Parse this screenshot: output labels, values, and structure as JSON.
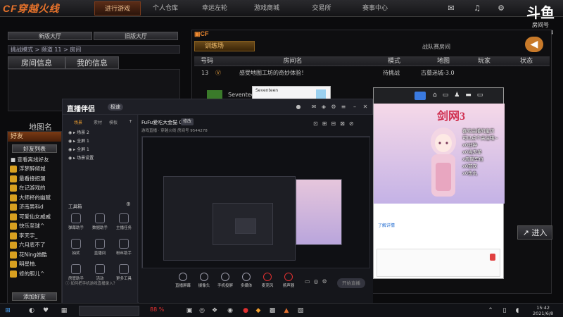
{
  "game": {
    "logo": "CF穿越火线",
    "nav": [
      "进行游戏",
      "个人仓库",
      "幸运左轮",
      "游戏商城",
      "交易所",
      "赛事中心"
    ],
    "lobby_new": "新版大厅",
    "lobby_old": "旧版大厅",
    "breadcrumb": "挑战模式 > 频道 11 > 房间",
    "tab_room_info": "房间信息",
    "tab_my_info": "我的信息",
    "map_name": "地图名",
    "training": "训练场",
    "team_war": "战队赛房间",
    "enter": "进入",
    "columns": [
      "号码",
      "房间名",
      "模式",
      "地图",
      "玩家",
      "状态"
    ],
    "rooms": [
      {
        "num": "13",
        "name": "感受地图工坊的奇妙体验！",
        "mode": "待挑战",
        "map": "古墓迷城-3.0"
      },
      {
        "num": "",
        "name": "Seventeen",
        "mode": "",
        "map": ""
      }
    ]
  },
  "douyu": {
    "mark": "斗鱼",
    "label": "房间号",
    "room": "9544278"
  },
  "friends": {
    "header": "好友",
    "tab": "好友列表",
    "show_offline": "查看离线好友",
    "list": [
      "浮梦醉倾城",
      "最看接招漏",
      "在记游戏的",
      "大师杯的幽赋",
      "济南男科d",
      "可爱仙女威威",
      "快乐至球^",
      "李天宇_",
      "六月底不了",
      "花Ning她酷",
      "明星柚.",
      "修的胆儿^"
    ],
    "add": "添加好友"
  },
  "popup": {
    "line1": "Seventeen",
    "line2": ""
  },
  "app": {
    "logo": "直播伴侣",
    "badge": "极速",
    "side_tabs": [
      "场景",
      "素材",
      "模板"
    ],
    "scenes": [
      "场景 2",
      "全屏 1",
      "全屏 1",
      "场景设置"
    ],
    "tools_label": "工具箱",
    "tools": [
      "弹幕助手",
      "数据助手",
      "主播任务",
      "抽奖",
      "直播间",
      "粉丝助手",
      "房管助手",
      "活动",
      "更多工具"
    ],
    "stream_title": "FuFu爱吃大金猫 0.0",
    "stream_edit": "修改",
    "stream_info": "游戏直播 · 穿越火线  房间号 9544278",
    "bottom_tools": [
      "直播屏幕",
      "摄像头",
      "手机投屏",
      "多媒体",
      "麦克风",
      "扬声器"
    ],
    "start": "开始直播",
    "tip": "如何把手机游戏直播录入？"
  },
  "browser": {
    "banner": "剑网3",
    "notes": [
      "喜欢主播的宝贝",
      "可以点个关注哦~",
      "x0分钟",
      "x0当天单",
      "x周周车位",
      "x0首次",
      "x0鱼丸"
    ],
    "chat_link": "了解详情"
  },
  "taskbar": {
    "cpu": "88 %",
    "time": "15:42",
    "date": "2021/6/8"
  }
}
